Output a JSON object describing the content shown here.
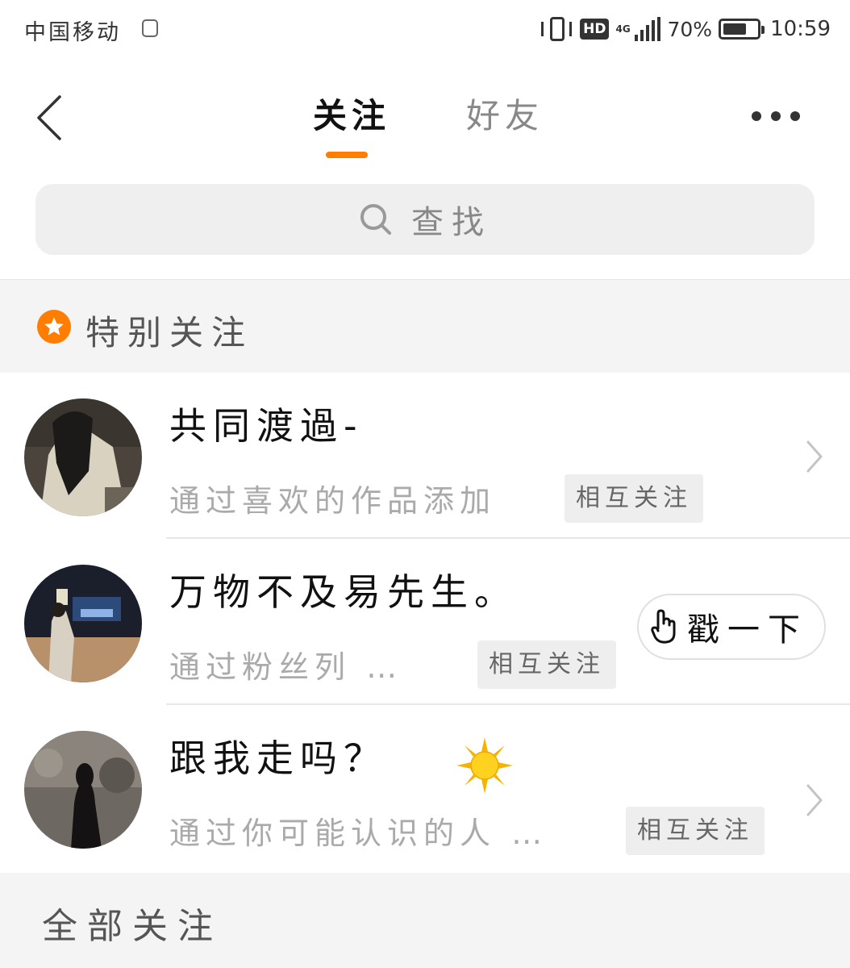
{
  "status_bar": {
    "carrier": "中国移动",
    "hd": "HD",
    "network": "4G",
    "battery_percent": "70%",
    "battery_level": 0.7,
    "time": "10:59"
  },
  "nav": {
    "tabs": [
      {
        "label": "关注",
        "active": true
      },
      {
        "label": "好友",
        "active": false
      }
    ],
    "accent_color": "#ff7d00"
  },
  "search": {
    "placeholder": "查找"
  },
  "special_section": {
    "title": "特别关注"
  },
  "contacts": [
    {
      "name": "共同渡過-",
      "source": "通过喜欢的作品添加",
      "tag": "相互关注",
      "action": "chevron"
    },
    {
      "name": "万物不及易先生。",
      "source": "通过粉丝列 …",
      "tag": "相互关注",
      "action": "poke",
      "action_label": "戳一下"
    },
    {
      "name": "跟我走吗？",
      "source": "通过你可能认识的人 …",
      "tag": "相互关注",
      "action": "chevron",
      "emoji": "sun-icon"
    }
  ],
  "all_section": {
    "title": "全部关注"
  }
}
